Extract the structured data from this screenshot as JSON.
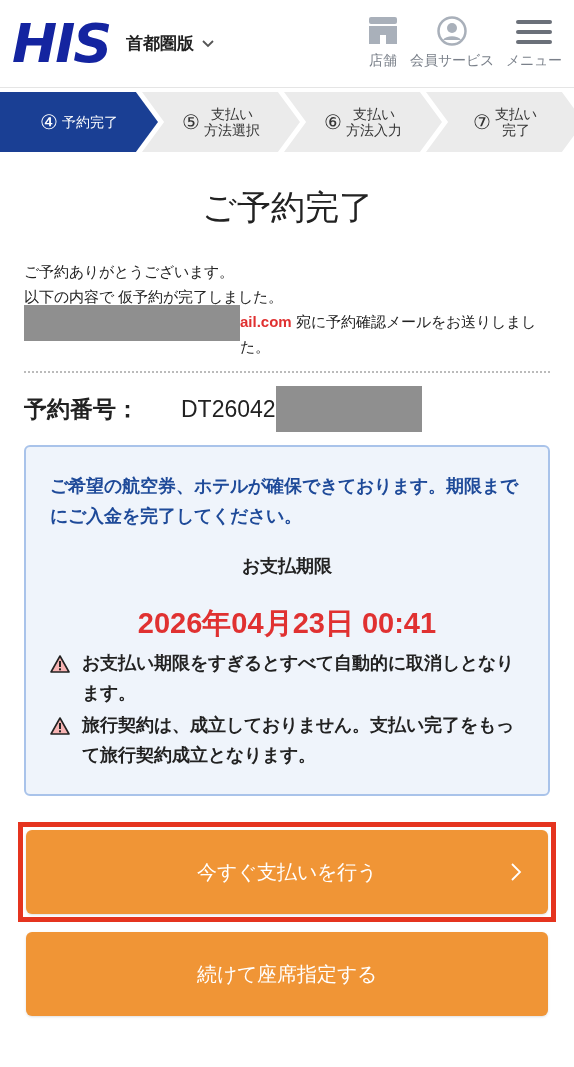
{
  "header": {
    "logo": "HIS",
    "region": "首都圏版",
    "nav": [
      {
        "kind": "store",
        "label": "店舗"
      },
      {
        "kind": "member",
        "label": "会員サービス"
      },
      {
        "kind": "menu",
        "label": "メニュー"
      }
    ]
  },
  "steps": [
    {
      "number": "④",
      "label": "予約完了",
      "selected": true
    },
    {
      "number": "⑤",
      "label": "支払い",
      "label_2": "方法選択",
      "selected": false
    },
    {
      "number": "⑥",
      "label": "支払い",
      "label_2": "方法入力",
      "selected": false
    },
    {
      "number": "⑦",
      "label": "支払い",
      "label_2": "完了",
      "selected": false
    }
  ],
  "title": "ご予約完了",
  "messages": [
    "ご予約ありがとうございます。",
    "以下の内容で 仮予約が完了しました。"
  ],
  "email_notice": {
    "email": "ail.com",
    "text": " 宛に予約確認メールをお送りしました。"
  },
  "reservation": {
    "label": "予約番号：",
    "number": "DT26042"
  },
  "notice_box": {
    "message": "ご希望の航空券、ホテルが確保できております。期限までにご入金を完了してください。",
    "deadline_label": "お支払期限",
    "deadline": "2026年04月23日 00:41",
    "warnings": [
      "お支払い期限をすぎるとすべて自動的に取消しとなります。",
      "旅行契約は、成立しておりません。支払い完了をもって旅行契約成立となります。"
    ]
  },
  "buttons": [
    {
      "label": "今すぐ支払いを行う",
      "highlighted": true,
      "chevron": true
    },
    {
      "label": "続けて座席指定する",
      "highlighted": false,
      "chevron": false
    }
  ]
}
